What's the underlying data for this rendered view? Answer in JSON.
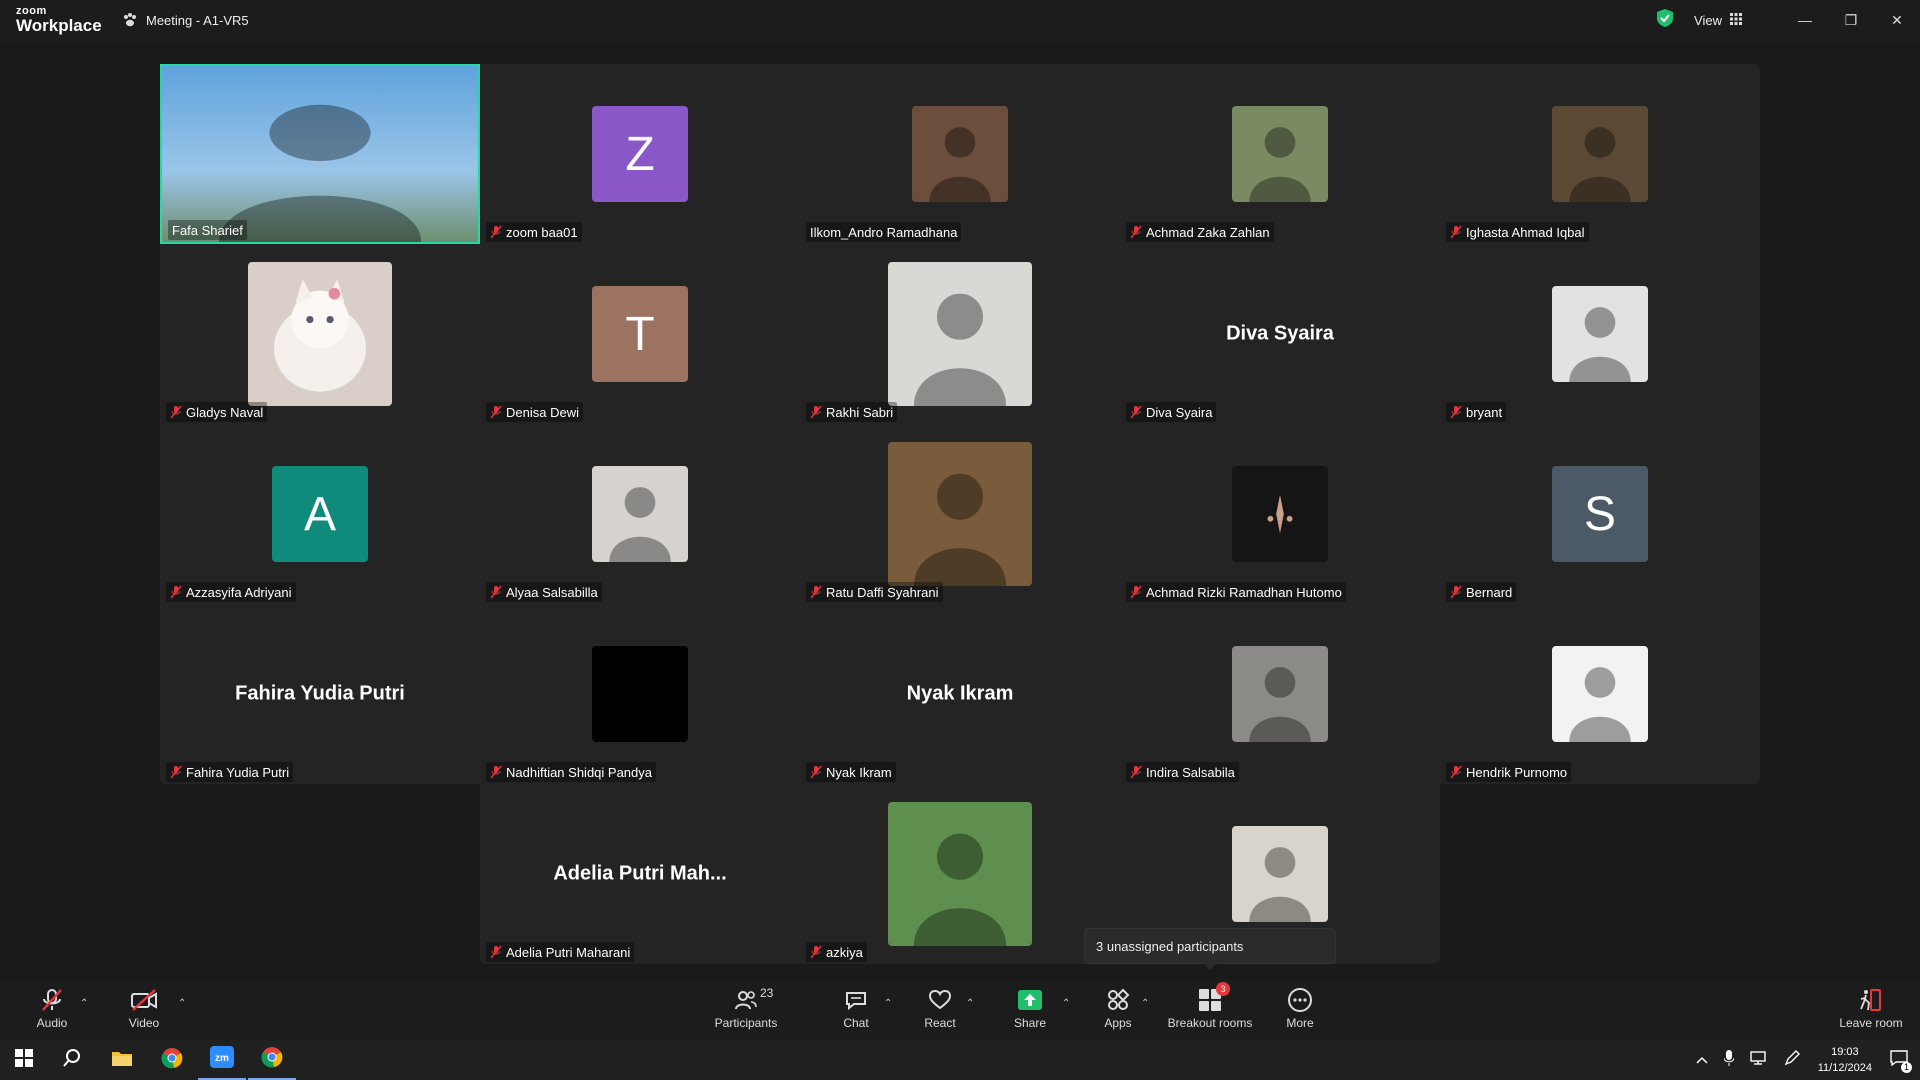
{
  "titlebar": {
    "logo_line1": "zoom",
    "logo_line2": "Workplace",
    "meeting_title": "Meeting - A1-VR5",
    "view_label": "View"
  },
  "participants": [
    {
      "name": "Fafa Sharief",
      "type": "photo",
      "icon": "person-photo",
      "color": "#5a87b8",
      "active": true
    },
    {
      "name": "zoom baa01",
      "type": "letter",
      "letter": "Z",
      "color": "#8a57c9"
    },
    {
      "name": "Ilkom_Andro Ramadhana",
      "type": "photo",
      "icon": "person-photo",
      "color": "#6b4e3d"
    },
    {
      "name": "Achmad Zaka Zahlan",
      "type": "photo",
      "icon": "person-photo",
      "color": "#7a8a63"
    },
    {
      "name": "Ighasta Ahmad Iqbal",
      "type": "photo",
      "icon": "person-photo",
      "color": "#5c4a36"
    },
    {
      "name": "Gladys Naval",
      "type": "bigphoto",
      "icon": "cat-photo",
      "color": "#d9cfc8"
    },
    {
      "name": "Denisa Dewi",
      "type": "letter",
      "letter": "T",
      "color": "#9c7261"
    },
    {
      "name": "Rakhi Sabri",
      "type": "bigphoto",
      "icon": "person-photo",
      "color": "#d8d8d4"
    },
    {
      "name": "Diva Syaira",
      "type": "text",
      "display": "Diva Syaira"
    },
    {
      "name": "bryant",
      "type": "photo",
      "icon": "person-photo",
      "color": "#e2e2e2"
    },
    {
      "name": "Azzasyifa Adriyani",
      "type": "letter",
      "letter": "A",
      "color": "#0f8a7b"
    },
    {
      "name": "Alyaa Salsabilla",
      "type": "photo",
      "icon": "person-photo",
      "color": "#d6d3cf"
    },
    {
      "name": "Ratu Daffi Syahrani",
      "type": "bigphoto",
      "icon": "person-photo",
      "color": "#7a5c3c"
    },
    {
      "name": "Achmad Rizki Ramadhan Hutomo",
      "type": "photo",
      "icon": "logo-photo",
      "color": "#151515"
    },
    {
      "name": "Bernard",
      "type": "letter",
      "letter": "S",
      "color": "#4b5a66"
    },
    {
      "name": "Fahira Yudia Putri",
      "type": "text",
      "display": "Fahira Yudia Putri"
    },
    {
      "name": "Nadhiftian Shidqi Pandya",
      "type": "photo",
      "icon": "black-photo",
      "color": "#000000"
    },
    {
      "name": "Nyak Ikram",
      "type": "text",
      "display": "Nyak Ikram"
    },
    {
      "name": "Indira Salsabila",
      "type": "photo",
      "icon": "person-photo",
      "color": "#8c8a86"
    },
    {
      "name": "Hendrik Purnomo",
      "type": "photo",
      "icon": "person-photo",
      "color": "#f2f2f2"
    },
    {
      "name": "Adelia Putri Maharani",
      "type": "text",
      "display": "Adelia Putri Mah..."
    },
    {
      "name": "azkiya",
      "type": "bigphoto",
      "icon": "person-photo",
      "color": "#5e8f4e"
    },
    {
      "name": "",
      "type": "photo",
      "icon": "person-photo",
      "color": "#d9d4cb"
    }
  ],
  "tooltip": "3 unassigned participants",
  "toolbar": {
    "audio": "Audio",
    "video": "Video",
    "participants": "Participants",
    "participant_count": "23",
    "chat": "Chat",
    "react": "React",
    "share": "Share",
    "apps": "Apps",
    "breakout": "Breakout rooms",
    "breakout_badge": "3",
    "more": "More",
    "leave": "Leave room"
  },
  "taskbar": {
    "time": "19:03",
    "date": "11/12/2024",
    "notif_count": "1"
  },
  "colors": {
    "accent_active": "#23d9a5",
    "share_green": "#1fbf6b",
    "muted_red": "#e5373c"
  }
}
